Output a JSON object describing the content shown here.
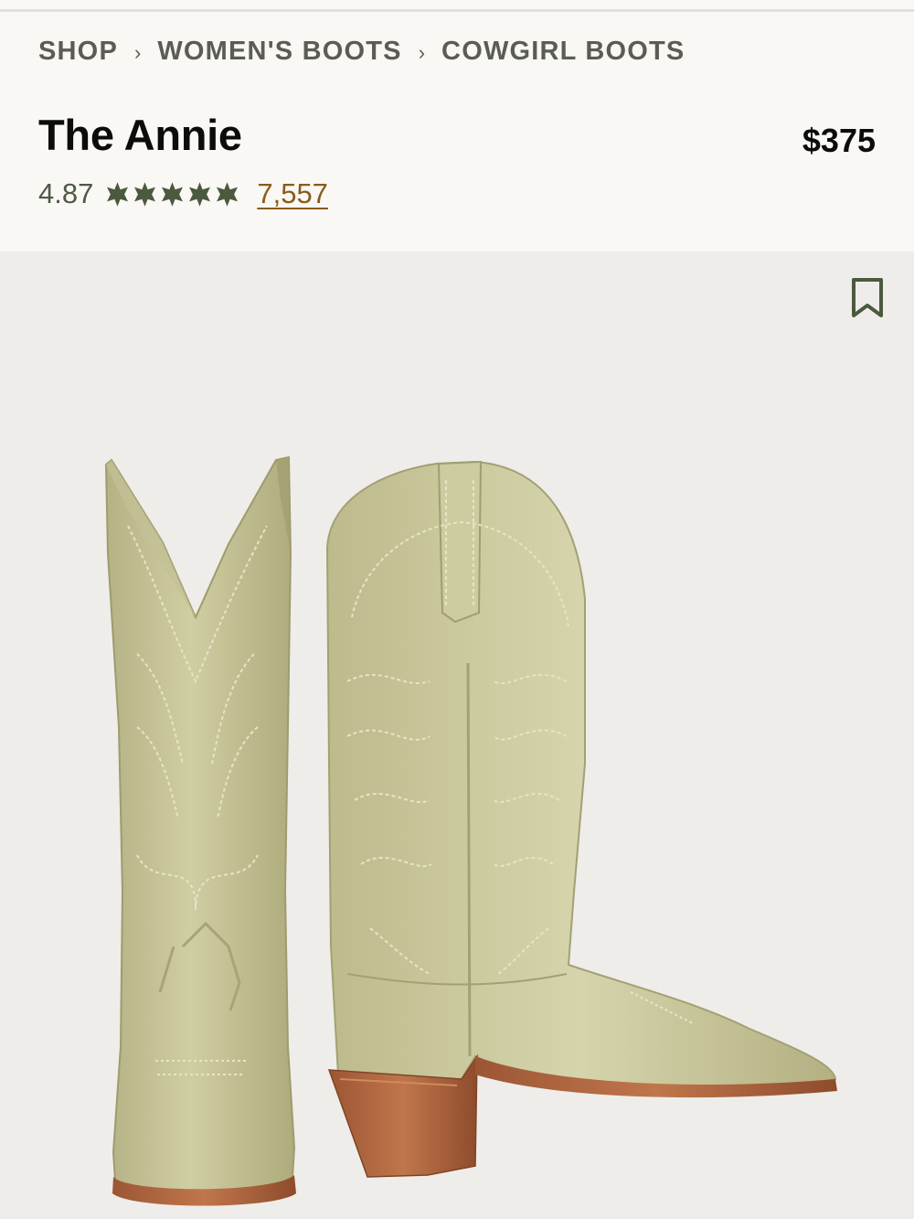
{
  "breadcrumb": {
    "items": [
      "SHOP",
      "WOMEN'S BOOTS",
      "COWGIRL BOOTS"
    ],
    "separator": "›"
  },
  "product": {
    "title": "The Annie",
    "price": "$375",
    "rating": "4.87",
    "stars": 5,
    "review_count": "7,557"
  },
  "icons": {
    "star": "star-icon",
    "bookmark": "bookmark-icon"
  },
  "colors": {
    "star": "#4b5a3e",
    "link": "#8a5a1e",
    "boot_leather": "#c9c79a",
    "heel": "#a8603a"
  }
}
